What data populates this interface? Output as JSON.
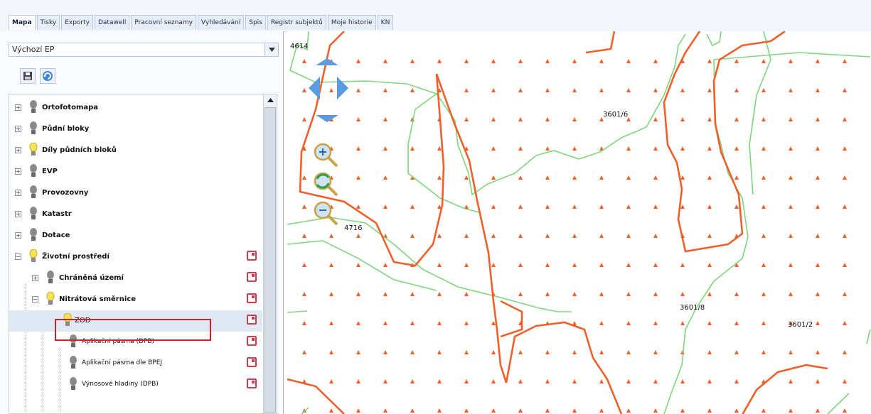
{
  "tabs": [
    "Mapa",
    "Tisky",
    "Exporty",
    "Datawell",
    "Pracovní seznamy",
    "Vyhledávání",
    "Spis",
    "Registr subjektů",
    "Moje historie",
    "KN"
  ],
  "active_tab": "Mapa",
  "select": {
    "value": "Výchozí EP"
  },
  "tree": {
    "items": [
      {
        "label": "Ortofotomapa",
        "bulb": "grey"
      },
      {
        "label": "Půdní bloky",
        "bulb": "grey"
      },
      {
        "label": "Díly půdních bloků",
        "bulb": "yellow"
      },
      {
        "label": "EVP",
        "bulb": "grey"
      },
      {
        "label": "Provozovny",
        "bulb": "grey"
      },
      {
        "label": "Katastr",
        "bulb": "grey"
      },
      {
        "label": "Dotace",
        "bulb": "grey"
      },
      {
        "label": "Životní prostředí",
        "bulb": "yellow"
      },
      {
        "label": "Chráněná území",
        "bulb": "grey"
      },
      {
        "label": "Nitrátová směrnice",
        "bulb": "yellow"
      },
      {
        "label": "ZOD",
        "bulb": "yellow"
      },
      {
        "label": "Aplikační pásma (DPB)",
        "bulb": "grey"
      },
      {
        "label": "Aplikační pásma dle BPEJ",
        "bulb": "grey"
      },
      {
        "label": "Výnosové hladiny (DPB)",
        "bulb": "grey"
      }
    ]
  },
  "map": {
    "parcel_labels": [
      "4614",
      "3601/6",
      "4716",
      "3601/8",
      "3601/2"
    ],
    "colors": {
      "zone_boundary": "#f0602a",
      "parcel_boundary": "#7ed67e",
      "nav": "#4e8ed3"
    }
  }
}
